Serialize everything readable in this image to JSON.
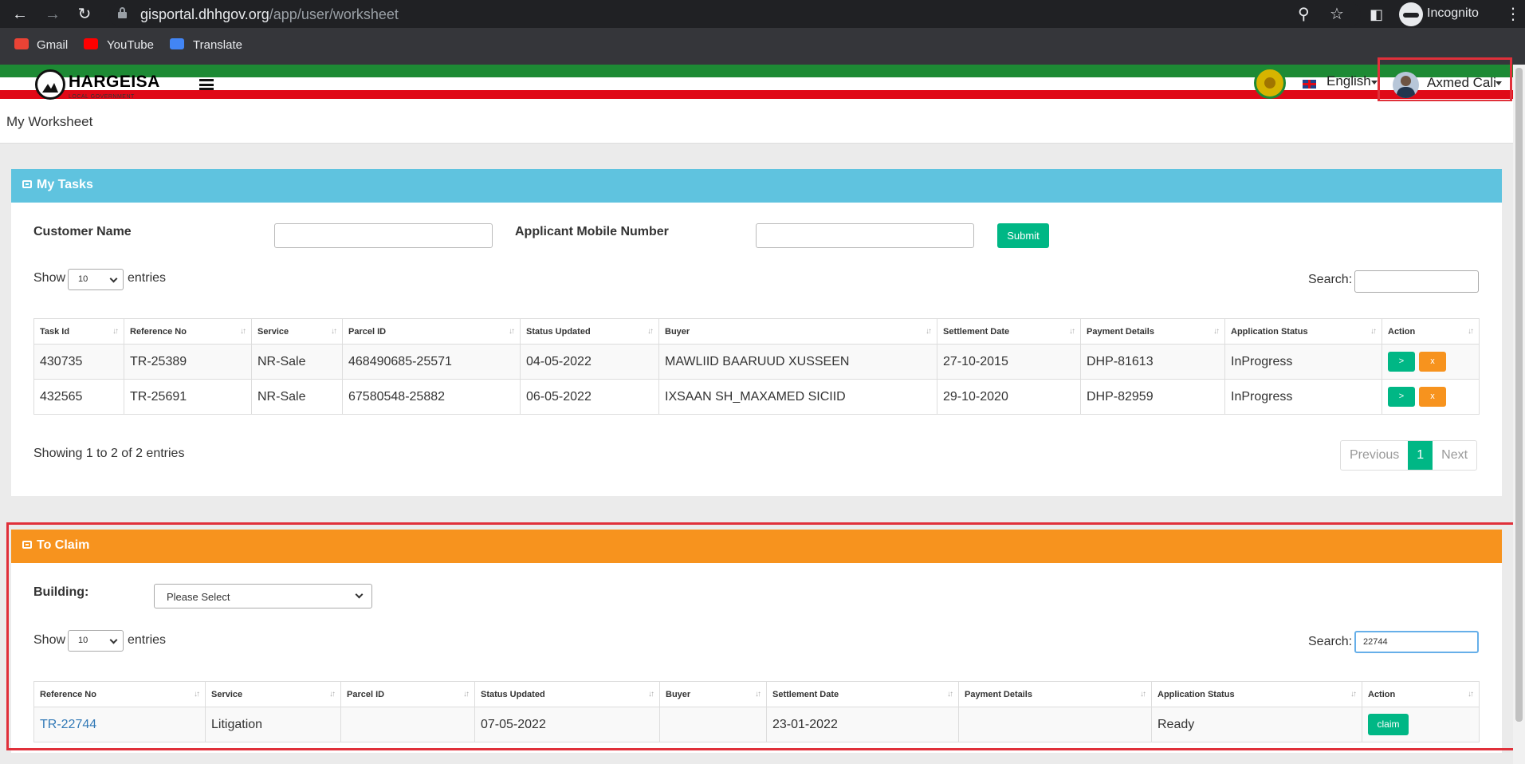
{
  "browser": {
    "url_host": "gisportal.dhhgov.org",
    "url_path": "/app/user/worksheet",
    "profile_label": "Incognito",
    "bookmarks": [
      "Gmail",
      "YouTube",
      "Translate"
    ]
  },
  "header": {
    "logo_text": "HARGEISA",
    "logo_subtext": "LOCAL GOVERNMENT",
    "language": "English",
    "user_name": "Axmed Cali"
  },
  "page": {
    "title": "My Worksheet"
  },
  "my_tasks": {
    "title": "My Tasks",
    "header_color": "#5fc3df",
    "customer_name_label": "Customer Name",
    "customer_name_value": "",
    "mobile_label": "Applicant Mobile Number",
    "mobile_value": "",
    "submit_label": "Submit",
    "show_label": "Show",
    "entries_label": "entries",
    "page_size": "10",
    "search_label": "Search:",
    "search_value": "",
    "columns": [
      "Task Id",
      "Reference No",
      "Service",
      "Parcel ID",
      "Status Updated",
      "Buyer",
      "Settlement Date",
      "Payment Details",
      "Application Status",
      "Action"
    ],
    "rows": [
      [
        "430735",
        "TR-25389",
        "NR-Sale",
        "468490685-25571",
        "04-05-2022",
        "MAWLIID BAARUUD XUSSEEN",
        "27-10-2015",
        "DHP-81613",
        "InProgress"
      ],
      [
        "432565",
        "TR-25691",
        "NR-Sale",
        "67580548-25882",
        "06-05-2022",
        "IXSAAN SH_MAXAMED SICIID",
        "29-10-2020",
        "DHP-82959",
        "InProgress"
      ]
    ],
    "action_go": ">",
    "action_x": "x",
    "info": "Showing 1 to 2 of 2 entries",
    "pagination": {
      "previous": "Previous",
      "current": "1",
      "next": "Next"
    }
  },
  "to_claim": {
    "title": "To Claim",
    "header_color": "#f7931e",
    "building_label": "Building:",
    "building_value": "Please Select",
    "show_label": "Show",
    "entries_label": "entries",
    "page_size": "10",
    "search_label": "Search:",
    "search_value": "22744",
    "columns": [
      "Reference No",
      "Service",
      "Parcel ID",
      "Status Updated",
      "Buyer",
      "Settlement Date",
      "Payment Details",
      "Application Status",
      "Action"
    ],
    "rows": [
      [
        "TR-22744",
        "Litigation",
        "",
        "07-05-2022",
        "",
        "23-01-2022",
        "",
        "Ready"
      ]
    ],
    "claim_label": "claim"
  }
}
